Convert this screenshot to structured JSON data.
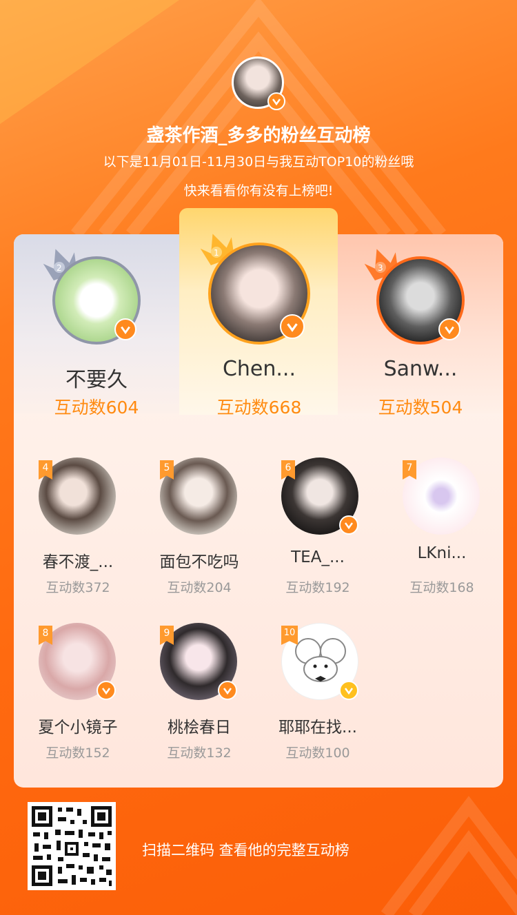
{
  "header": {
    "title": "盏茶作酒_多多的粉丝互动榜",
    "subtitle_line1": "以下是11月01日-11月30日与我互动TOP10的粉丝哦",
    "subtitle_line2": "快来看看你有没有上榜吧!"
  },
  "podium": [
    {
      "rank": "2",
      "name": "不要久",
      "count": "互动数604"
    },
    {
      "rank": "1",
      "name": "Chen...",
      "count": "互动数668"
    },
    {
      "rank": "3",
      "name": "Sanw...",
      "count": "互动数504"
    }
  ],
  "fans": [
    {
      "rank": "4",
      "name": "春不渡_...",
      "count": "互动数372"
    },
    {
      "rank": "5",
      "name": "面包不吃吗",
      "count": "互动数204"
    },
    {
      "rank": "6",
      "name": "TEA_...",
      "count": "互动数192"
    },
    {
      "rank": "7",
      "name": "LKni...",
      "count": "互动数168"
    },
    {
      "rank": "8",
      "name": "夏个小镜子",
      "count": "互动数152"
    },
    {
      "rank": "9",
      "name": "桃桧春日",
      "count": "互动数132"
    },
    {
      "rank": "10",
      "name": "耶耶在找...",
      "count": "互动数100"
    }
  ],
  "footer": {
    "qr_caption": "扫描二维码 查看他的完整互动榜"
  },
  "colors": {
    "accent": "#ff8a10",
    "background": "#ff6a10",
    "badge": "#ff8a1e"
  }
}
